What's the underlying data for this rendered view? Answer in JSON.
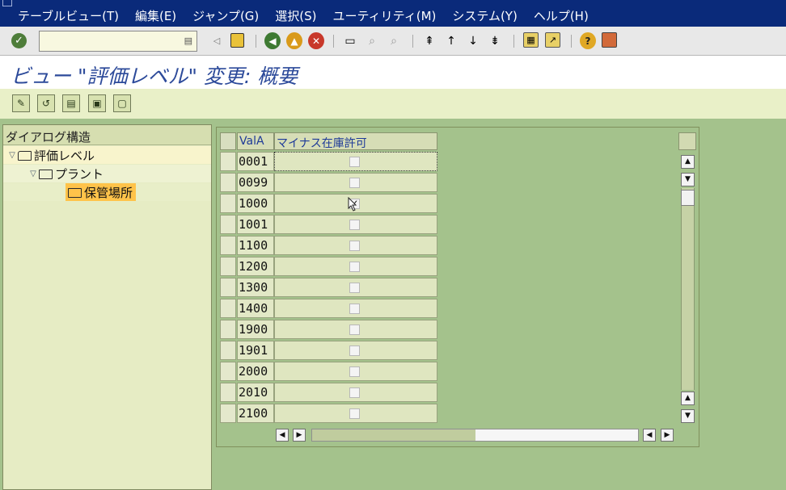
{
  "menu": [
    "テーブルビュー(T)",
    "編集(E)",
    "ジャンプ(G)",
    "選択(S)",
    "ユーティリティ(M)",
    "システム(Y)",
    "ヘルプ(H)"
  ],
  "toolbar": {
    "command_field_value": "",
    "icons": [
      "enter-icon",
      "save-icon",
      "back-icon",
      "exit-icon",
      "cancel-icon",
      "print-icon",
      "find-icon",
      "find-next-icon",
      "first-page-icon",
      "previous-page-icon",
      "next-page-icon",
      "last-page-icon",
      "create-session-icon",
      "shortcut-icon",
      "help-icon",
      "layout-icon"
    ]
  },
  "title": "ビュー \"評価レベル\" 変更: 概要",
  "app_toolbar": [
    "edit-icon",
    "change-display-icon",
    "details-icon",
    "select-all-icon",
    "deselect-icon"
  ],
  "tree": {
    "header": "ダイアログ構造",
    "nodes": [
      {
        "label": "評価レベル",
        "level": 0,
        "expanded": true
      },
      {
        "label": "プラント",
        "level": 1,
        "expanded": true
      },
      {
        "label": "保管場所",
        "level": 2,
        "selected": true
      }
    ]
  },
  "table": {
    "columns": [
      "ValA",
      "マイナス在庫許可"
    ],
    "rows": [
      {
        "vala": "0001",
        "checked": false
      },
      {
        "vala": "0099",
        "checked": false
      },
      {
        "vala": "1000",
        "checked": true
      },
      {
        "vala": "1001",
        "checked": false
      },
      {
        "vala": "1100",
        "checked": false
      },
      {
        "vala": "1200",
        "checked": false
      },
      {
        "vala": "1300",
        "checked": false
      },
      {
        "vala": "1400",
        "checked": false
      },
      {
        "vala": "1900",
        "checked": false
      },
      {
        "vala": "1901",
        "checked": false
      },
      {
        "vala": "2000",
        "checked": false
      },
      {
        "vala": "2010",
        "checked": false
      },
      {
        "vala": "2100",
        "checked": false
      }
    ],
    "checkmark_glyph": "✓",
    "horizontal_scroll_fraction": 0.5
  },
  "colors": {
    "menubar": "#0a2a7a",
    "title_text": "#2c4a9a",
    "background": "#a4c28c",
    "tree_selected": "#ffc34a",
    "column_header_text": "#1e3a98"
  }
}
